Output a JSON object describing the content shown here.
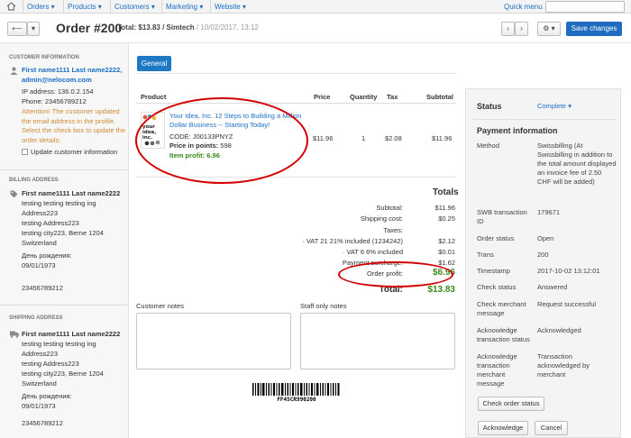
{
  "nav": {
    "menus": [
      "Orders",
      "Products",
      "Customers",
      "Marketing",
      "Website"
    ],
    "quick_menu": "Quick menu"
  },
  "title": {
    "order": "Order #200",
    "total": "Total: $13.83 / Simtech",
    "date": "/ 10/02/2017, 13:12",
    "save": "Save changes"
  },
  "customer": {
    "heading": "Customer information",
    "name_email": "First name1111 Last name2222, admin@nelocom.com",
    "ip": "IP address: 136.0.2.154",
    "phone": "Phone: 23456789212",
    "attention": "Attention! The customer updated the email address in the profile. Select the check box to update the order details:",
    "update_label": "Update customer information"
  },
  "billing": {
    "heading": "Billing address",
    "name": "First name1111 Last name2222",
    "line1": "testing testing testing ing",
    "line2": "Address223",
    "line3": "testing Address223",
    "line4": "testing city223, Berne 1204",
    "line5": "Switzerland",
    "birthday_label": "День рождения:",
    "birthday": "09/01/1973",
    "phone": "23456789212"
  },
  "shipping": {
    "heading": "Shipping address",
    "name": "First name1111 Last name2222",
    "line1": "testing testing testing ing",
    "line2": "Address223",
    "line3": "testing Address223",
    "line4": "testing city223, Berne 1204",
    "line5": "Switzerland",
    "birthday_label": "День рождения:",
    "birthday": "09/01/1973",
    "phone": "23456789212"
  },
  "tabs": {
    "general": "General"
  },
  "products": {
    "headers": {
      "product": "Product",
      "price": "Price",
      "quantity": "Quantity",
      "tax": "Tax",
      "subtotal": "Subtotal"
    },
    "item": {
      "name": "Your Idea, Inc. 12 Steps to Building a Million Dollar Business -- Starting Today!",
      "code": "CODE: J00133PNYZ",
      "points_label": "Price in points:",
      "points": "598",
      "profit_label": "Item profit:",
      "profit": "6.96",
      "price": "$11.96",
      "quantity": "1",
      "tax": "$2.08",
      "subtotal": "$11.96"
    }
  },
  "totals": {
    "title": "Totals",
    "subtotal_label": "Subtotal:",
    "subtotal": "$11.96",
    "shipping_label": "Shipping cost:",
    "shipping": "$0.25",
    "taxes_label": "Taxes:",
    "vat21_label": "· VAT 21 21% included (1234242)",
    "vat21": "$2.12",
    "vat6_label": "· VAT 6 6% included",
    "vat6": "$0.01",
    "surcharge_label": "Payment surcharge:",
    "surcharge": "$1.62",
    "profit_label": "Order profit:",
    "profit": "$6.96",
    "total_label": "Total:",
    "total": "$13.83"
  },
  "notes": {
    "customer": "Customer notes",
    "staff": "Staff only notes"
  },
  "barcode_text": "FF45CR990200",
  "status_panel": {
    "status_label": "Status",
    "status_value": "Complete",
    "payment_title": "Payment information",
    "method_label": "Method",
    "method_value": "Swissbilling (At Swissbilling in addition to the total amount displayed an invoice fee of 2.50 CHF will be added)",
    "swb_label": "SWB transaction ID",
    "swb_value": "179671",
    "order_status_label": "Order status",
    "order_status_value": "Open",
    "trans_label": "Trans",
    "trans_value": "200",
    "timestamp_label": "Timestamp",
    "timestamp_value": "2017-10-02 13:12:01",
    "check_status_label": "Check status",
    "check_status_value": "Answered",
    "check_msg_label": "Check merchant message",
    "check_msg_value": "Request successful",
    "ack_status_label": "Acknowledge transaction status",
    "ack_status_value": "Acknowledged",
    "ack_msg_label": "Acknowledge transaction merchant message",
    "ack_msg_value": "Transaction acknowledged by merchant",
    "check_order_btn": "Check order status",
    "acknowledge_btn": "Acknowledge",
    "cancel_btn": "Cancel"
  },
  "colors": {
    "accent": "#1f6bbf",
    "link": "#1a6fc4",
    "profit": "#3a8a1a",
    "attention": "#d08a35",
    "annotation": "#d40000"
  }
}
